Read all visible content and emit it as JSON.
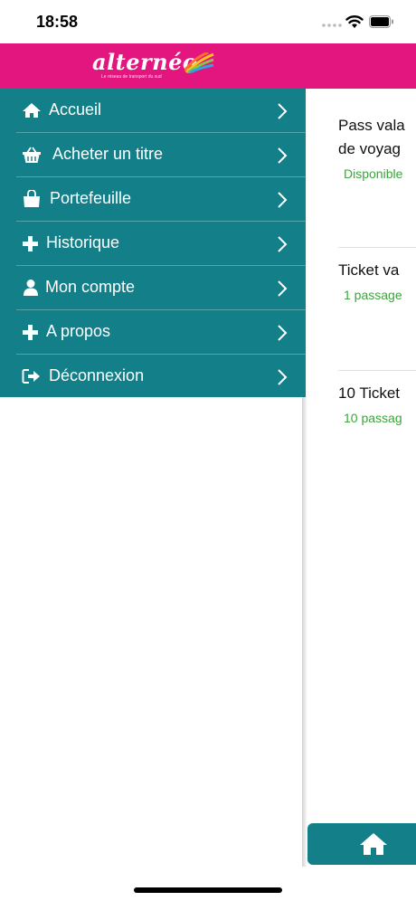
{
  "status": {
    "time": "18:58"
  },
  "brand": {
    "logo_text": "alternéo",
    "tagline": "Le réseau de transport du sud"
  },
  "menu": {
    "items": [
      {
        "label": "Accueil",
        "icon": "home-icon"
      },
      {
        "label": "Acheter un titre",
        "icon": "basket-icon"
      },
      {
        "label": "Portefeuille",
        "icon": "bag-icon"
      },
      {
        "label": "Historique",
        "icon": "plus-icon"
      },
      {
        "label": "Mon compte",
        "icon": "user-icon"
      },
      {
        "label": "A propos",
        "icon": "plus-icon"
      },
      {
        "label": "Déconnexion",
        "icon": "signout-icon"
      }
    ]
  },
  "content": {
    "cards": [
      {
        "title_1": "Pass vala",
        "title_2": "de voyag",
        "sub": "Disponible"
      },
      {
        "title_1": "Ticket va",
        "sub": "1 passage"
      },
      {
        "title_1": "10 Ticket",
        "sub": "10 passag"
      }
    ]
  },
  "colors": {
    "brand_pink": "#e3157f",
    "teal": "#127f89",
    "green": "#3aa53a"
  }
}
